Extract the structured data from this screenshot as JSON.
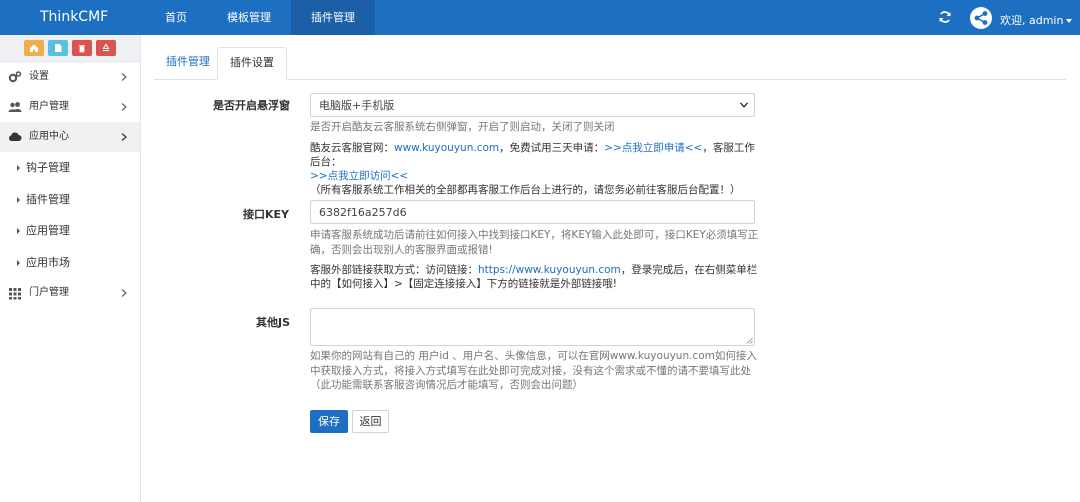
{
  "header": {
    "brand": "ThinkCMF",
    "nav": [
      {
        "label": "首页"
      },
      {
        "label": "模板管理"
      },
      {
        "label": "插件管理"
      }
    ],
    "user_greeting": "欢迎, admin"
  },
  "sidebar": {
    "shortcuts": [
      {
        "icon": "home-icon",
        "color": "#f0ad4e"
      },
      {
        "icon": "file-icon",
        "color": "#5bc0de"
      },
      {
        "icon": "trash-icon",
        "color": "#d9534f"
      },
      {
        "icon": "recycle-icon",
        "color": "#d9534f"
      }
    ],
    "menu": [
      {
        "label": "设置",
        "icon": "gear-icon"
      },
      {
        "label": "用户管理",
        "icon": "users-icon"
      },
      {
        "label": "应用中心",
        "icon": "cloud-icon"
      }
    ],
    "submenu": [
      {
        "label": "钩子管理"
      },
      {
        "label": "插件管理"
      },
      {
        "label": "应用管理"
      },
      {
        "label": "应用市场"
      }
    ],
    "menu_after": {
      "label": "门户管理",
      "icon": "grid-icon"
    }
  },
  "tabs": [
    {
      "label": "插件管理"
    },
    {
      "label": "插件设置"
    }
  ],
  "form": {
    "float": {
      "label": "是否开启悬浮窗",
      "value": "电脑版+手机版",
      "help": "是否开启酷友云客服系统右侧弹窗，开启了则启动，关闭了则关闭",
      "note_prefix": "酷友云客服官网：",
      "note_site": "www.kuyouyun.com",
      "note_mid": "，免费试用三天申请：",
      "note_apply": ">>点我立即申请<<",
      "note_backend": "，客服工作后台：",
      "note_visit": ">>点我立即访问<<",
      "note_tip": "（所有客服系统工作相关的全部都再客服工作后台上进行的，请您务必前往客服后台配置！）"
    },
    "key": {
      "label": "接口KEY",
      "value": "6382f16a257d6",
      "help": "申请客服系统成功后请前往如何接入中找到接口KEY，将KEY输入此处即可，接口KEY必须填写正确，否则会出现别人的客服界面或报错!",
      "note_prefix": "客服外部链接获取方式：访问链接：",
      "note_link": "https://www.kuyouyun.com",
      "note_rest": "，登录完成后，在右侧菜单栏中的【如何接入】>【固定连接接入】下方的链接就是外部链接哦!"
    },
    "js": {
      "label": "其他JS",
      "help": "如果你的网站有自己的 用户id 、用户名、头像信息，可以在官网www.kuyouyun.com如何接入中获取接入方式，将接入方式填写在此处即可完成对接，没有这个需求或不懂的请不要填写此处（此功能需联系客服咨询情况后才能填写，否则会出问题）"
    },
    "save_label": "保存",
    "back_label": "返回"
  },
  "colors": {
    "topbar": "#1d6fc2",
    "accent": "#1d6fc2"
  }
}
